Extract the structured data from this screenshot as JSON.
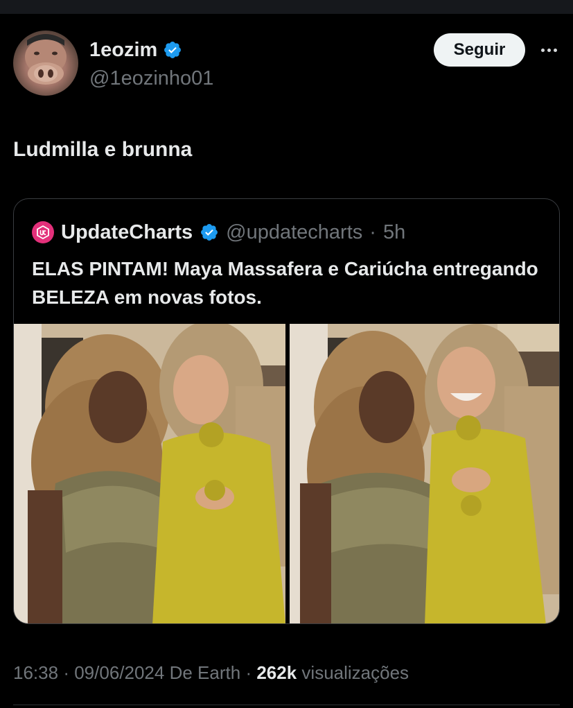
{
  "post": {
    "author_name": "1eozim",
    "author_handle": "@1eozinho01",
    "follow_label": "Seguir",
    "text": "Ludmilla e brunna",
    "avatar_icon": "pig-face-avatar",
    "verified_icon": "verified-badge-icon",
    "verified_color": "#1d9bf0"
  },
  "quote": {
    "author_name": "UpdateCharts",
    "author_handle": "@updatecharts",
    "separator": "·",
    "time": "5h",
    "text": "ELAS PINTAM! Maya Massafera e Cariúcha entregando BELEZA em novas fotos.",
    "avatar_color": "#e3307a",
    "images": [
      {
        "name": "photo-left",
        "description_icon": "photo"
      },
      {
        "name": "photo-right",
        "description_icon": "photo"
      }
    ]
  },
  "meta": {
    "time": "16:38",
    "dot1": "·",
    "date": "09/06/2024",
    "source": "De Earth",
    "dot2": "·",
    "views_count": "262k",
    "views_label": "visualizações"
  },
  "colors": {
    "background": "#000000",
    "text_primary": "#e7e9ea",
    "text_secondary": "#71767b",
    "border": "#3a3d41",
    "button_bg": "#eff3f4"
  }
}
